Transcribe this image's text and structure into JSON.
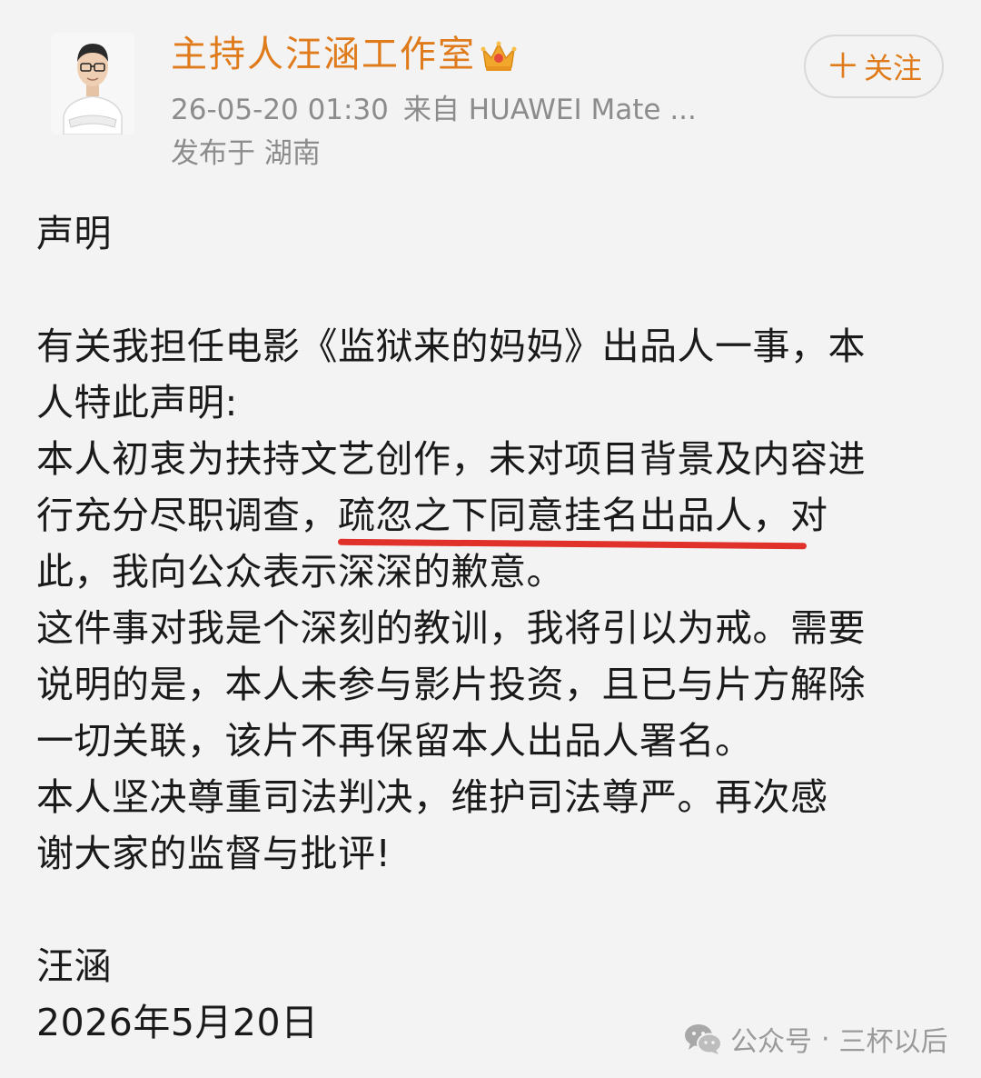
{
  "header": {
    "account_name": "主持人汪涵工作室",
    "timestamp": "26-05-20 01:30",
    "source": "来自 HUAWEI Mate ...",
    "location": "发布于 湖南",
    "follow_label": "关注",
    "follow_icon": "plus-icon",
    "badge_icon": "crown-icon",
    "accent_color": "#e07b1c"
  },
  "post": {
    "title": "声明",
    "lines": [
      "有关我担任电影《监狱来的妈妈》出品人一事，本",
      "人特此声明:",
      "本人初衷为扶持文艺创作，未对项目背景及内容进",
      "行充分尽职调查，",
      "疏忽之下同意挂名出品人，",
      "对",
      "此，我向公众表示深深的歉意。",
      "这件事对我是个深刻的教训，我将引以为戒。需要",
      "说明的是，本人未参与影片投资，且已与片方解除",
      "一切关联，该片不再保留本人出品人署名。",
      "本人坚决尊重司法判决，维护司法尊严。再次感",
      "谢大家的监督与批评!"
    ],
    "signature": "汪涵",
    "date": "2026年5月20日",
    "highlight_color": "#e0322b"
  },
  "watermark": {
    "platform": "公众号",
    "separator": "·",
    "account": "三杯以后"
  }
}
